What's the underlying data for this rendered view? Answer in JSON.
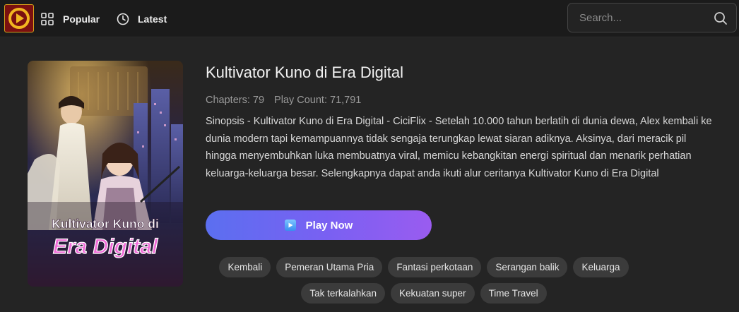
{
  "header": {
    "nav": [
      {
        "label": "Popular",
        "icon": "grid-icon"
      },
      {
        "label": "Latest",
        "icon": "clock-icon"
      }
    ],
    "search_placeholder": "Search..."
  },
  "detail": {
    "title": "Kultivator Kuno di Era Digital",
    "chapters": "Chapters: 79",
    "play_count": "Play Count: 71,791",
    "synopsis": "Sinopsis - Kultivator Kuno di Era Digital - CiciFlix - Setelah 10.000 tahun berlatih di dunia dewa, Alex kembali ke dunia modern tapi kemampuannya tidak sengaja terungkap lewat siaran adiknya. Aksinya, dari meracik pil hingga menyembuhkan luka membuatnya viral, memicu kebangkitan energi spiritual dan menarik perhatian keluarga-keluarga besar. Selengkapnya dapat anda ikuti alur ceritanya Kultivator Kuno di Era Digital",
    "play_button": "Play Now",
    "poster": {
      "line1": "Kultivator Kuno di",
      "line2": "Era Digital"
    },
    "tags": [
      "Kembali",
      "Pemeran Utama Pria",
      "Fantasi perkotaan",
      "Serangan balik",
      "Keluarga",
      "Tak terkalahkan",
      "Kekuatan super",
      "Time Travel"
    ]
  },
  "colors": {
    "background": "#242424",
    "header": "#1b1b1b",
    "accent_start": "#5b6ff0",
    "accent_end": "#9a5cf0",
    "tag_bg": "#3b3b3b"
  }
}
